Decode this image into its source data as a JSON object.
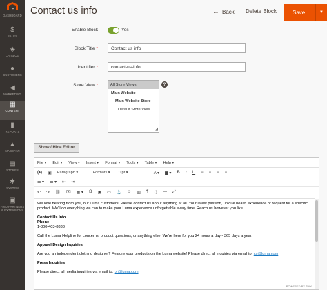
{
  "sidebar": {
    "logo": "magento-logo",
    "items": [
      {
        "label": "DASHBOARD",
        "icon": "dashboard-icon",
        "glyph": "◔"
      },
      {
        "label": "SALES",
        "icon": "dollar-icon",
        "glyph": "$"
      },
      {
        "label": "CATALOG",
        "icon": "cube-icon",
        "glyph": "◈"
      },
      {
        "label": "CUSTOMERS",
        "icon": "person-icon",
        "glyph": "●"
      },
      {
        "label": "MARKETING",
        "icon": "megaphone-icon",
        "glyph": "◀"
      },
      {
        "label": "CONTENT",
        "icon": "content-icon",
        "glyph": "▦"
      },
      {
        "label": "REPORTS",
        "icon": "bar-chart-icon",
        "glyph": "▮"
      },
      {
        "label": "MAGEFAN",
        "icon": "magefan-icon",
        "glyph": "▲"
      },
      {
        "label": "STORES",
        "icon": "store-icon",
        "glyph": "▤"
      },
      {
        "label": "SYSTEM",
        "icon": "gear-icon",
        "glyph": "✱"
      },
      {
        "label": "FIND PARTNERS & EXTENSIONS",
        "icon": "partners-icon",
        "glyph": "▣"
      }
    ]
  },
  "header": {
    "title": "Contact us info",
    "back_label": "Back",
    "delete_label": "Delete Block",
    "save_label": "Save"
  },
  "form": {
    "enable_label": "Enable Block",
    "enable_value": "Yes",
    "title_label": "Block Title",
    "title_value": "Contact us info",
    "identifier_label": "Identifier",
    "identifier_value": "contact-us-info",
    "store_view_label": "Store View",
    "store_options": [
      "All Store Views",
      "Main Website",
      "Main Website Store",
      "Default Store View"
    ],
    "store_selected": "All Store Views"
  },
  "editor": {
    "show_hide_label": "Show / Hide Editor",
    "menu": [
      "File",
      "Edit",
      "View",
      "Insert",
      "Format",
      "Tools",
      "Table",
      "Help"
    ],
    "toolbar": {
      "block_format": "Paragraph",
      "formats": "Formats",
      "font_size": "11pt"
    },
    "content": {
      "p1": "We love hearing from you, our Luma customers. Please contact us about anything at all. Your latest passion, unique health experience or request for a specific product. We'll do everything we can to make your Luma experience unforgettable every time. Reach us however you like",
      "contact_heading": "Contact Us Info",
      "phone_label": "Phone",
      "phone_number": "1-800-403-8838",
      "p2": "Call the Luma Helpline for concerns, product questions, or anything else. We're here for you 24 hours a day - 365 days a year.",
      "apparel_heading": "Apparel Design Inquiries",
      "p3_text": "Are you an independent clothing designer? Feature your products on the Luma website! Please direct all inquiries via email to: ",
      "p3_email": "cs@luma.com",
      "press_heading": "Press Inquiries",
      "p4_text": "Please direct all media inquiries via email to: ",
      "p4_email": "pr@luma.com"
    },
    "powered_by": "POWERED BY TINY"
  },
  "colors": {
    "accent": "#eb5202",
    "sidebar_bg": "#373330",
    "toggle_on": "#79a22e",
    "link": "#1979c3"
  }
}
